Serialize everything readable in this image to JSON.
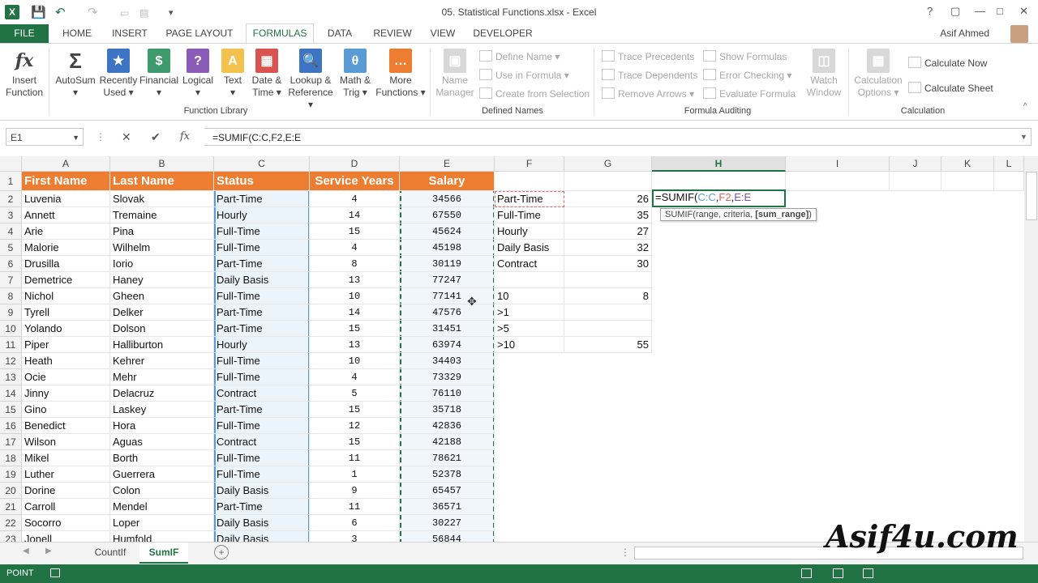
{
  "window": {
    "title": "05. Statistical Functions.xlsx - Excel",
    "controls": [
      "?",
      "▢",
      "—",
      "□",
      "✕"
    ]
  },
  "tabs": [
    {
      "label": "FILE"
    },
    {
      "label": "HOME"
    },
    {
      "label": "INSERT"
    },
    {
      "label": "PAGE LAYOUT"
    },
    {
      "label": "FORMULAS"
    },
    {
      "label": "DATA"
    },
    {
      "label": "REVIEW"
    },
    {
      "label": "VIEW"
    },
    {
      "label": "DEVELOPER"
    }
  ],
  "user": "Asif Ahmed",
  "ribbon": {
    "insert_function": {
      "line1": "Insert",
      "line2": "Function"
    },
    "autosum": {
      "line1": "AutoSum",
      "line2": "▾"
    },
    "recently_used": {
      "line1": "Recently",
      "line2": "Used ▾"
    },
    "financial": {
      "line1": "Financial",
      "line2": "▾"
    },
    "logical": {
      "line1": "Logical",
      "line2": "▾"
    },
    "text": {
      "line1": "Text",
      "line2": "▾"
    },
    "date_time": {
      "line1": "Date &",
      "line2": "Time ▾"
    },
    "lookup": {
      "line1": "Lookup &",
      "line2": "Reference ▾"
    },
    "math": {
      "line1": "Math &",
      "line2": "Trig ▾"
    },
    "more": {
      "line1": "More",
      "line2": "Functions ▾"
    },
    "group_function_library": "Function Library",
    "name_manager": {
      "line1": "Name",
      "line2": "Manager"
    },
    "define_name": "Define Name ▾",
    "use_in_formula": "Use in Formula ▾",
    "create_from_selection": "Create from Selection",
    "group_defined_names": "Defined Names",
    "trace_precedents": "Trace Precedents",
    "trace_dependents": "Trace Dependents",
    "remove_arrows": "Remove Arrows ▾",
    "show_formulas": "Show Formulas",
    "error_checking": "Error Checking ▾",
    "evaluate_formula": "Evaluate Formula",
    "watch_window": {
      "line1": "Watch",
      "line2": "Window"
    },
    "group_formula_auditing": "Formula Auditing",
    "calc_options": {
      "line1": "Calculation",
      "line2": "Options ▾"
    },
    "calculate_now": "Calculate Now",
    "calculate_sheet": "Calculate Sheet",
    "group_calculation": "Calculation"
  },
  "formula_bar": {
    "name_box": "E1",
    "cancel": "✕",
    "enter": "✔",
    "fx": "fx",
    "formula": "=SUMIF(C:C,F2,E:E"
  },
  "columns": [
    "A",
    "B",
    "C",
    "D",
    "E",
    "F",
    "G",
    "H",
    "I",
    "J",
    "K",
    "L"
  ],
  "header_row": [
    "First Name",
    "Last Name",
    "Status",
    "Service Years",
    "Salary"
  ],
  "rows": [
    [
      "Luvenia",
      "Slovak",
      "Part-Time",
      "4",
      "34566"
    ],
    [
      "Annett",
      "Tremaine",
      "Hourly",
      "14",
      "67550"
    ],
    [
      "Arie",
      "Pina",
      "Full-Time",
      "15",
      "45624"
    ],
    [
      "Malorie",
      "Wilhelm",
      "Full-Time",
      "4",
      "45198"
    ],
    [
      "Drusilla",
      "Iorio",
      "Part-Time",
      "8",
      "30119"
    ],
    [
      "Demetrice",
      "Haney",
      "Daily Basis",
      "13",
      "77247"
    ],
    [
      "Nichol",
      "Gheen",
      "Full-Time",
      "10",
      "77141"
    ],
    [
      "Tyrell",
      "Delker",
      "Part-Time",
      "14",
      "47576"
    ],
    [
      "Yolando",
      "Dolson",
      "Part-Time",
      "15",
      "31451"
    ],
    [
      "Piper",
      "Halliburton",
      "Hourly",
      "13",
      "63974"
    ],
    [
      "Heath",
      "Kehrer",
      "Full-Time",
      "10",
      "34403"
    ],
    [
      "Ocie",
      "Mehr",
      "Full-Time",
      "4",
      "73329"
    ],
    [
      "Jinny",
      "Delacruz",
      "Contract",
      "5",
      "76110"
    ],
    [
      "Gino",
      "Laskey",
      "Part-Time",
      "15",
      "35718"
    ],
    [
      "Benedict",
      "Hora",
      "Full-Time",
      "12",
      "42836"
    ],
    [
      "Wilson",
      "Aguas",
      "Contract",
      "15",
      "42188"
    ],
    [
      "Mikel",
      "Borth",
      "Full-Time",
      "11",
      "78621"
    ],
    [
      "Luther",
      "Guerrera",
      "Full-Time",
      "1",
      "52378"
    ],
    [
      "Dorine",
      "Colon",
      "Daily Basis",
      "9",
      "65457"
    ],
    [
      "Carroll",
      "Mendel",
      "Part-Time",
      "11",
      "36571"
    ],
    [
      "Socorro",
      "Loper",
      "Daily Basis",
      "6",
      "30227"
    ],
    [
      "Jonell",
      "Humfold",
      "Daily Basis",
      "3",
      "56844"
    ]
  ],
  "criteria_F": [
    "Part-Time",
    "Full-Time",
    "Hourly",
    "Daily Basis",
    "Contract",
    "",
    "10",
    ">1",
    ">5",
    ">10"
  ],
  "results_G": [
    "26",
    "35",
    "27",
    "32",
    "30",
    "",
    "8",
    "",
    "",
    "55"
  ],
  "editing_cell": {
    "prefix": "=SUMIF(",
    "arg1": "C:C",
    "arg2": "F2",
    "arg3": "E:E"
  },
  "tooltip": {
    "text": "SUMIF(range, criteria, ",
    "bold": "[sum_range]",
    "close": ")"
  },
  "sheets": [
    "CountIf",
    "SumIF"
  ],
  "status": "POINT",
  "watermark": "Asif4u.com",
  "colors": {
    "excel_green": "#217346",
    "header_orange": "#ed7d31",
    "selection_blue": "#5b9bd5"
  }
}
